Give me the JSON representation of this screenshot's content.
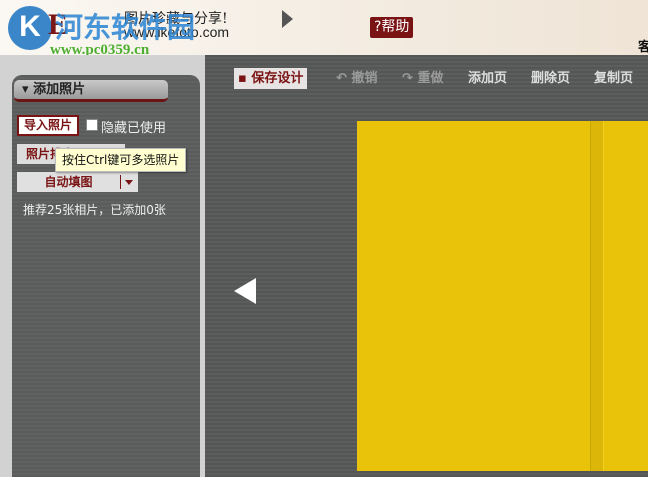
{
  "header": {
    "logo_letters": "IKE",
    "watermark_name": "河东软件园",
    "watermark_url": "www.pc0359.cn",
    "slogan": "图片珍藏与分享!",
    "site_url": "www.ikefoto.com",
    "help_label": "?帮助",
    "cut_text": "客"
  },
  "left_panel": {
    "title": "添加照片",
    "import_button": "导入照片",
    "hide_used_label": "隐藏已使用",
    "hide_used_checked": false,
    "sort_button": "照片排序",
    "auto_fill_button": "自动填图",
    "hint": "推荐25张相片，已添加0张",
    "tooltip": "按住Ctrl键可多选照片"
  },
  "toolbar": {
    "save": "保存设计",
    "undo": "撤销",
    "redo": "重做",
    "add_page": "添加页",
    "delete_page": "删除页",
    "copy_page": "复制页"
  },
  "colors": {
    "accent": "#7a1414",
    "canvas": "#e8c30a"
  }
}
